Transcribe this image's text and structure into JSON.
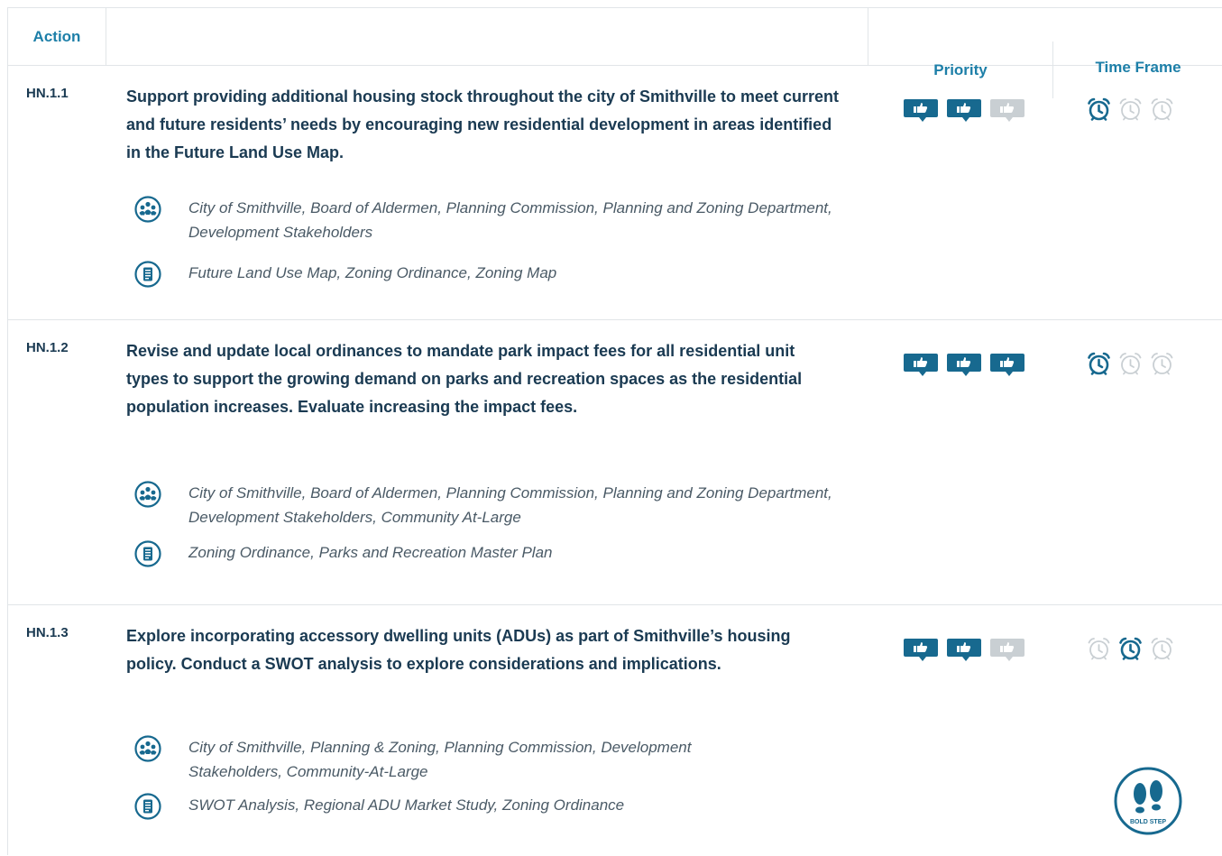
{
  "header": {
    "action": "Action",
    "description": "",
    "priority": "Priority",
    "time_frame": "Time Frame"
  },
  "colors": {
    "accent": "#1d7fa8",
    "active_icon": "#17698f",
    "inactive_icon": "#c9cfd3",
    "text": "#1a3a52"
  },
  "icons": {
    "partners": "partners-icon",
    "resources": "document-icon",
    "priority": "thumbs-up-icon",
    "time_frame": "alarm-clock-icon",
    "bold_step": "footprints-icon"
  },
  "rows": [
    {
      "id": "HN.1.1",
      "title": "Support providing additional housing stock throughout the city of Smithville to meet current and future residents’ needs by encouraging new residential development in areas identified in the Future Land Use Map.",
      "partners": "City of Smithville, Board of Aldermen, Planning Commission, Planning and Zoning Department, Development Stakeholders",
      "resources": "Future Land Use Map, Zoning Ordinance, Zoning Map",
      "priority": [
        true,
        true,
        false
      ],
      "time_frame": [
        true,
        false,
        false
      ]
    },
    {
      "id": "HN.1.2",
      "title": "Revise and update local ordinances to mandate park impact fees for all residential unit types to support the growing demand on parks and recreation spaces as the residential population increases. Evaluate increasing the impact fees.",
      "partners": "City of Smithville, Board of Aldermen, Planning Commission, Planning and Zoning Department, Development Stakeholders, Community At-Large",
      "resources": "Zoning Ordinance, Parks and Recreation Master Plan",
      "priority": [
        true,
        true,
        true
      ],
      "time_frame": [
        true,
        false,
        false
      ]
    },
    {
      "id": "HN.1.3",
      "title": "Explore incorporating accessory dwelling units (ADUs) as part of Smithville’s housing policy. Conduct a SWOT analysis to explore considerations and implications.",
      "partners": "City of Smithville, Planning & Zoning, Planning Commission, Development Stakeholders, Community-At-Large",
      "resources": "SWOT Analysis, Regional ADU Market Study, Zoning Ordinance",
      "priority": [
        true,
        true,
        false
      ],
      "time_frame": [
        false,
        true,
        false
      ],
      "badge": "BOLD STEP"
    }
  ]
}
